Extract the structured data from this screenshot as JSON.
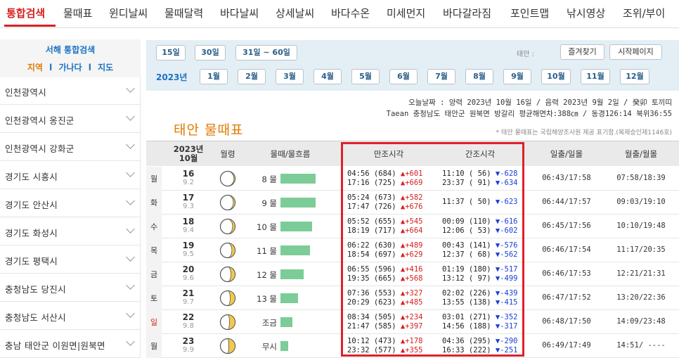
{
  "nav": {
    "tabs": [
      "통합검색",
      "물때표",
      "윈디날씨",
      "물때달력",
      "바다날씨",
      "상세날씨",
      "바다수온",
      "미세먼지",
      "바다갈라짐",
      "포인트맵",
      "낚시영상",
      "조위/부이"
    ],
    "active_color": "#d62020"
  },
  "sidebar": {
    "title": "서해 통합검색",
    "subtabs": [
      "지역",
      "가나다",
      "지도"
    ],
    "sep": "l",
    "regions": [
      "인천광역시",
      "인천광역시 옹진군",
      "인천광역시 강화군",
      "경기도 시흥시",
      "경기도 안산시",
      "경기도 화성시",
      "경기도 평택시",
      "충청남도 당진시",
      "충청남도 서산시",
      "충남 태안군 이원면|원북면"
    ]
  },
  "selector": {
    "ranges": [
      "15일",
      "30일",
      "31일 ~ 60일"
    ],
    "area_label": "태안 :",
    "favorite": "즐겨찾기",
    "homepage": "시작페이지",
    "year": "2023년",
    "months": [
      "1월",
      "2월",
      "3월",
      "4월",
      "5월",
      "6월",
      "7월",
      "8월",
      "9월",
      "10월",
      "11월",
      "12월"
    ]
  },
  "info": {
    "today": "오늘날짜 : 양력 2023년 10월 16일 / 음력 2023년 9월 2일 / 癸卯 토끼띠",
    "location": "Taean 충청남도 태안군 원북면 방갈리 평균해면차:388㎝ / 동경126:14 북위36:55"
  },
  "page_title": "태안 물때표",
  "source": "* 태안 물때표는 국립해양조사원 제공 표기함.(복제승인제1146호)",
  "table": {
    "headers": {
      "date_year": "2023년",
      "date_month": "10월",
      "moon": "월령",
      "tide": "물때/물흐름",
      "high": "만조시각",
      "low": "간조시각",
      "sun": "일출/일몰",
      "moonrise": "월출/월몰"
    },
    "rows": [
      {
        "wd": "월",
        "day": "16",
        "lunar": "9.2",
        "phase": 0.08,
        "tide": "8 물",
        "flow": 0.8,
        "high1": "04:56 (684)",
        "hd1": "▲+601",
        "high2": "17:16 (725)",
        "hd2": "▲+669",
        "low1": "11:10 ( 56)",
        "ld1": "▼-628",
        "low2": "23:37 ( 91)",
        "ld2": "▼-634",
        "sun": "06:43/17:58",
        "moon": "07:58/18:39"
      },
      {
        "wd": "화",
        "day": "17",
        "lunar": "9.3",
        "phase": 0.12,
        "tide": "9 물",
        "flow": 0.8,
        "high1": "05:24 (673)",
        "hd1": "▲+582",
        "high2": "17:47 (726)",
        "hd2": "▲+676",
        "low1": "11:37 ( 50)",
        "ld1": "▼-623",
        "low2": "",
        "ld2": "",
        "sun": "06:44/17:57",
        "moon": "09:03/19:10"
      },
      {
        "wd": "수",
        "day": "18",
        "lunar": "9.4",
        "phase": 0.17,
        "tide": "10 물",
        "flow": 0.73,
        "high1": "05:52 (655)",
        "hd1": "▲+545",
        "high2": "18:19 (717)",
        "hd2": "▲+664",
        "low1": "00:09 (110)",
        "ld1": "▼-616",
        "low2": "12:06 ( 53)",
        "ld2": "▼-602",
        "sun": "06:45/17:56",
        "moon": "10:10/19:48"
      },
      {
        "wd": "목",
        "day": "19",
        "lunar": "9.5",
        "phase": 0.22,
        "tide": "11 물",
        "flow": 0.67,
        "high1": "06:22 (630)",
        "hd1": "▲+489",
        "high2": "18:54 (697)",
        "hd2": "▲+629",
        "low1": "00:43 (141)",
        "ld1": "▼-576",
        "low2": "12:37 ( 68)",
        "ld2": "▼-562",
        "sun": "06:46/17:54",
        "moon": "11:17/20:35"
      },
      {
        "wd": "금",
        "day": "20",
        "lunar": "9.6",
        "phase": 0.28,
        "tide": "12 물",
        "flow": 0.53,
        "high1": "06:55 (596)",
        "hd1": "▲+416",
        "high2": "19:35 (665)",
        "hd2": "▲+568",
        "low1": "01:19 (180)",
        "ld1": "▼-517",
        "low2": "13:12 ( 97)",
        "ld2": "▼-499",
        "sun": "06:46/17:53",
        "moon": "12:21/21:31"
      },
      {
        "wd": "토",
        "day": "21",
        "lunar": "9.7",
        "phase": 0.33,
        "tide": "13 물",
        "flow": 0.4,
        "high1": "07:36 (553)",
        "hd1": "▲+327",
        "high2": "20:29 (623)",
        "hd2": "▲+485",
        "low1": "02:02 (226)",
        "ld1": "▼-439",
        "low2": "13:55 (138)",
        "ld2": "▼-415",
        "sun": "06:47/17:52",
        "moon": "13:20/22:36"
      },
      {
        "wd": "일",
        "day": "22",
        "lunar": "9.8",
        "phase": 0.38,
        "tide": "조금",
        "flow": 0.28,
        "high1": "08:34 (505)",
        "hd1": "▲+234",
        "high2": "21:47 (585)",
        "hd2": "▲+397",
        "low1": "03:01 (271)",
        "ld1": "▼-352",
        "low2": "14:56 (188)",
        "ld2": "▼-317",
        "sun": "06:48/17:50",
        "moon": "14:09/23:48"
      },
      {
        "wd": "월",
        "day": "23",
        "lunar": "9.9",
        "phase": 0.43,
        "tide": "무시",
        "flow": 0.17,
        "high1": "10:12 (473)",
        "hd1": "▲+178",
        "high2": "23:32 (577)",
        "hd2": "▲+355",
        "low1": "04:36 (295)",
        "ld1": "▼-290",
        "low2": "16:33 (222)",
        "ld2": "▼-251",
        "sun": "06:49/17:49",
        "moon": "14:51/ ----"
      }
    ]
  },
  "colors": {
    "accent": "#d62020",
    "link": "#1a73c4",
    "orange": "#e07a00",
    "bar": "#7ccc97",
    "moon": "#f2c94c"
  }
}
